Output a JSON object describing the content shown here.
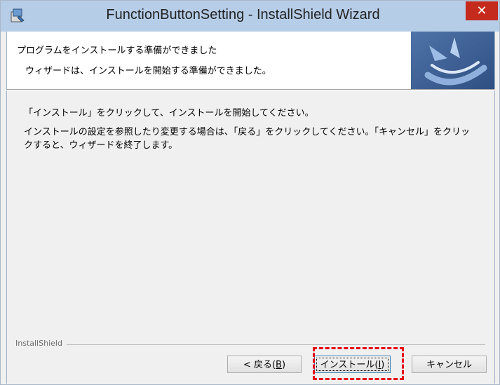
{
  "window": {
    "title": "FunctionButtonSetting - InstallShield Wizard",
    "close_glyph": "✕"
  },
  "header": {
    "heading": "プログラムをインストールする準備ができました",
    "subheading": "ウィザードは、インストールを開始する準備ができました。"
  },
  "content": {
    "paragraph1": "「インストール」をクリックして、インストールを開始してください。",
    "paragraph2": "インストールの設定を参照したり変更する場合は、「戻る」をクリックしてください。「キャンセル」をクリックすると、ウィザードを終了します。"
  },
  "footer": {
    "brand": "InstallShield",
    "back_label": "< 戻る(",
    "back_key": "B",
    "install_label": "インストール(",
    "install_key": "I",
    "key_close": ")",
    "cancel_label": "キャンセル"
  },
  "colors": {
    "titlebar": "#b6cde8",
    "close_button": "#c42b1c",
    "highlight": "#e60012",
    "logo": "#3a5a8c"
  },
  "icons": {
    "app": "installer-icon",
    "logo": "installshield-logo"
  }
}
